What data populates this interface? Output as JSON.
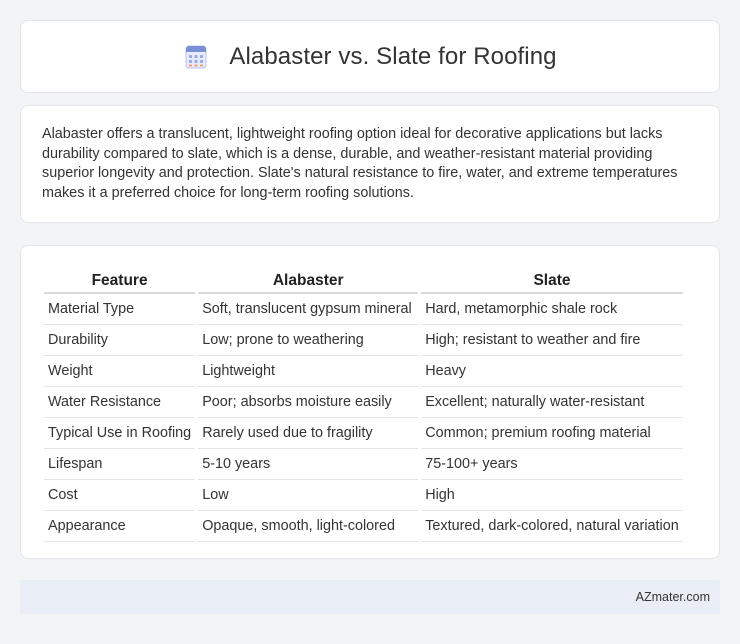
{
  "header": {
    "icon": "calculator-icon",
    "title": "Alabaster vs. Slate for Roofing"
  },
  "intro": {
    "text": "Alabaster offers a translucent, lightweight roofing option ideal for decorative applications but lacks durability compared to slate, which is a dense, durable, and weather-resistant material providing superior longevity and protection. Slate's natural resistance to fire, water, and extreme temperatures makes it a preferred choice for long-term roofing solutions."
  },
  "table": {
    "headers": [
      "Feature",
      "Alabaster",
      "Slate"
    ],
    "rows": [
      [
        "Material Type",
        "Soft, translucent gypsum mineral",
        "Hard, metamorphic shale rock"
      ],
      [
        "Durability",
        "Low; prone to weathering",
        "High; resistant to weather and fire"
      ],
      [
        "Weight",
        "Lightweight",
        "Heavy"
      ],
      [
        "Water Resistance",
        "Poor; absorbs moisture easily",
        "Excellent; naturally water-resistant"
      ],
      [
        "Typical Use in Roofing",
        "Rarely used due to fragility",
        "Common; premium roofing material"
      ],
      [
        "Lifespan",
        "5-10 years",
        "75-100+ years"
      ],
      [
        "Cost",
        "Low",
        "High"
      ],
      [
        "Appearance",
        "Opaque, smooth, light-colored",
        "Textured, dark-colored, natural variation"
      ]
    ]
  },
  "footer": {
    "text": "AZmater.com"
  },
  "colors": {
    "background": "#f3f4f6",
    "card": "#ffffff",
    "footer": "#e9edf5",
    "icon_accent": "#7b8fd6"
  }
}
